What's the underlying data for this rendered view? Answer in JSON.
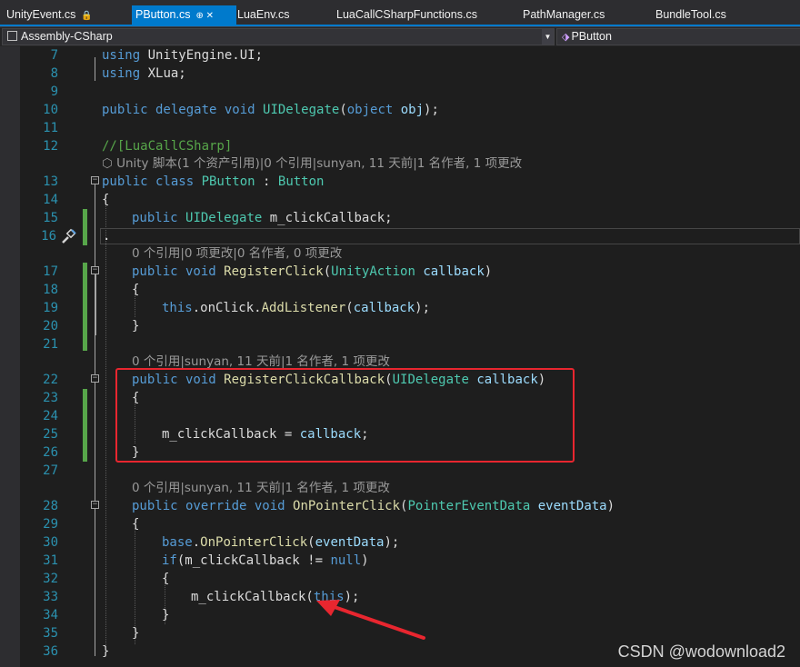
{
  "tabs": [
    {
      "label": "UnityEvent.cs",
      "glyph": "🔒",
      "active": false
    },
    {
      "label": "PButton.cs",
      "glyph": "⊕ ✕",
      "active": true
    },
    {
      "label": "LuaEnv.cs",
      "active": false
    },
    {
      "label": "LuaCallCSharpFunctions.cs",
      "active": false
    },
    {
      "label": "PathManager.cs",
      "active": false
    },
    {
      "label": "BundleTool.cs",
      "active": false
    }
  ],
  "navbar": {
    "project": "Assembly-CSharp",
    "type": "PButton"
  },
  "line_numbers": [
    "7",
    "8",
    "9",
    "10",
    "11",
    "12",
    "13",
    "14",
    "15",
    "16",
    "17",
    "18",
    "19",
    "20",
    "21",
    "22",
    "23",
    "24",
    "25",
    "26",
    "27",
    "28",
    "29",
    "30",
    "31",
    "32",
    "33",
    "34",
    "35",
    "36"
  ],
  "codelens": {
    "unity": "Unity 脚本(1 个资产引用)|0 个引用|sunyan, 11 天前|1 名作者, 1 项更改",
    "register_click": "0 个引用|0 项更改|0 名作者, 0 项更改",
    "register_click_callback": "0 个引用|sunyan, 11 天前|1 名作者, 1 项更改",
    "on_pointer_click": "0 个引用|sunyan, 11 天前|1 名作者, 1 项更改"
  },
  "code": {
    "l7_kw": "using",
    "l7_rest": " UnityEngine.UI;",
    "l8_kw": "using",
    "l8_rest": " XLua;",
    "l10_a": "public delegate void ",
    "l10_fn": "UIDelegate",
    "l10_p": "(",
    "l10_kw": "object",
    "l10_pa": " obj",
    "l10_end": ");",
    "l12": "//[LuaCallCSharp]",
    "l13_kw": "public class ",
    "l13_ty": "PButton",
    "l13_c": " : ",
    "l13_base": "Button",
    "l14": "{",
    "l15_kw": "public ",
    "l15_ty": "UIDelegate",
    "l15_rest": " m_clickCallback;",
    "l16": ".",
    "l17_kw": "public void ",
    "l17_fn": "RegisterClick",
    "l17_p": "(",
    "l17_ty": "UnityAction",
    "l17_pa": " callback",
    "l17_end": ")",
    "l18": "{",
    "l19_kw": "this",
    "l19_a": ".onClick.",
    "l19_fn": "AddListener",
    "l19_b": "(",
    "l19_pa": "callback",
    "l19_end": ");",
    "l20": "}",
    "l22_kw": "public void ",
    "l22_fn": "RegisterClickCallback",
    "l22_p": "(",
    "l22_ty": "UIDelegate",
    "l22_pa": " callback",
    "l22_end": ")",
    "l23": "{",
    "l25_a": "m_clickCallback = ",
    "l25_pa": "callback",
    "l25_end": ";",
    "l26": "}",
    "l28_kw": "public override void ",
    "l28_fn": "OnPointerClick",
    "l28_p": "(",
    "l28_ty": "PointerEventData",
    "l28_pa": " eventData",
    "l28_end": ")",
    "l29": "{",
    "l30_kw": "base",
    "l30_a": ".",
    "l30_fn": "OnPointerClick",
    "l30_b": "(",
    "l30_pa": "eventData",
    "l30_end": ");",
    "l31_kw": "if",
    "l31_a": "(m_clickCallback != ",
    "l31_kw2": "null",
    "l31_end": ")",
    "l32": "{",
    "l33_a": "m_clickCallback(",
    "l33_kw": "this",
    "l33_end": ");",
    "l34": "}",
    "l35": "}",
    "l36": "}"
  },
  "watermark": "CSDN @wodownload2",
  "colors": {
    "accent": "#007acc",
    "keyword": "#569cd6",
    "type": "#4ec9b0",
    "method": "#dcdcaa",
    "parameter": "#9cdcfe",
    "comment": "#57a64a",
    "line_number": "#2b91af",
    "annotation": "#e8262f"
  }
}
